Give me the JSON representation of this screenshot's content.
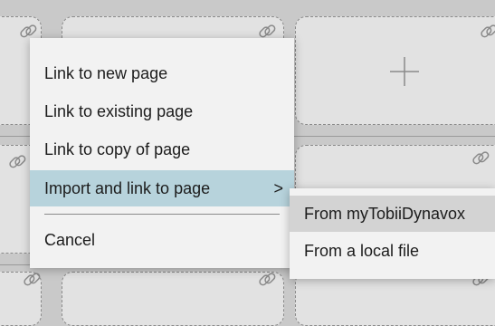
{
  "context_menu": {
    "items": [
      {
        "label": "Link to new page"
      },
      {
        "label": "Link to existing page"
      },
      {
        "label": "Link to copy of page"
      },
      {
        "label": "Import and link to page",
        "chevron": ">"
      },
      {
        "label": "Cancel"
      }
    ]
  },
  "submenu": {
    "items": [
      {
        "label": "From myTobiiDynavox"
      },
      {
        "label": "From a local file"
      }
    ]
  },
  "colors": {
    "background": "#c9c9c9",
    "tile": "#e2e2e2",
    "menu": "#f2f2f2",
    "active_item": "#b7d3dc",
    "hover_item": "#d3d3d3"
  },
  "icons": {
    "tile_link": "link-icon",
    "add_tile": "plus-icon"
  }
}
